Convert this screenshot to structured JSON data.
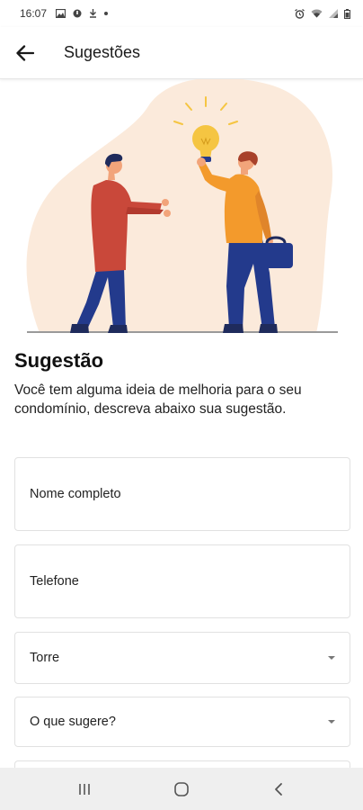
{
  "status_bar": {
    "time": "16:07",
    "left_icons": [
      "image-icon",
      "notification-icon",
      "download-icon",
      "dot-icon"
    ],
    "right_icons": [
      "alarm-icon",
      "wifi-icon",
      "signal-icon",
      "battery-icon"
    ]
  },
  "app_bar": {
    "back_icon": "arrow-left-icon",
    "title": "Sugestões"
  },
  "illustration": {
    "icon": "suggestion-illustration",
    "colors": {
      "blob": "#fbeadb",
      "bulb": "#f5c542",
      "ground": "#9a9a9a",
      "shirt_left": "#c9483a",
      "shirt_right": "#f39a2c",
      "pants": "#233a8c",
      "hair": "#1f2b5c"
    }
  },
  "content": {
    "title": "Sugestão",
    "description": "Você tem alguma ideia de melhoria para o seu condomínio, descreva abaixo sua sugestão."
  },
  "form": {
    "name_placeholder": "Nome completo",
    "phone_placeholder": "Telefone",
    "tower_label": "Torre",
    "suggestion_label": "O que sugere?"
  },
  "nav_bar": {
    "icons": [
      "recent-apps-icon",
      "home-icon",
      "back-icon"
    ]
  }
}
